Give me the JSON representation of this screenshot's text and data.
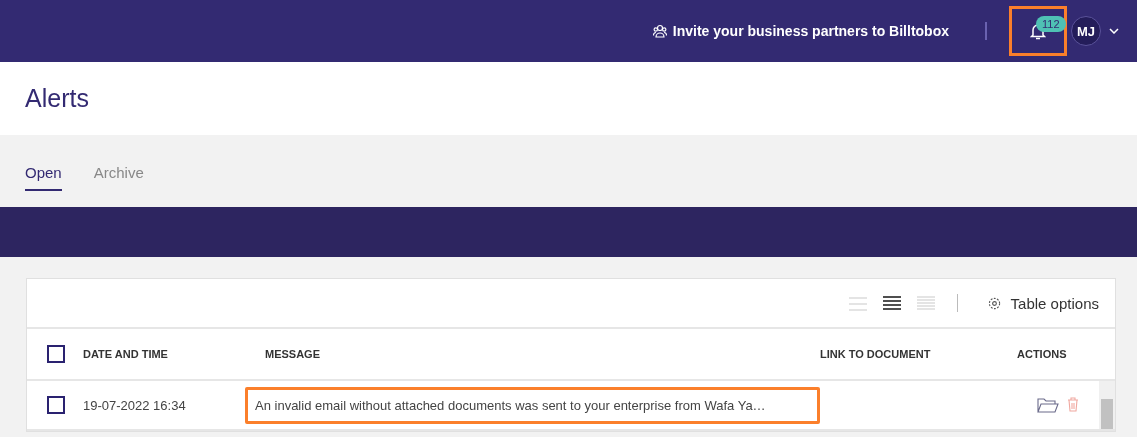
{
  "header": {
    "invite": "Invite your business partners to Billtobox",
    "notifications": {
      "count": "112",
      "highlighted": true
    },
    "user": {
      "initials": "MJ"
    }
  },
  "page": {
    "title": "Alerts"
  },
  "tabs": [
    {
      "label": "Open",
      "selected": true
    },
    {
      "label": "Archive",
      "selected": false
    }
  ],
  "toolbar": {
    "densities": [
      {
        "kind": "loose",
        "selected": false
      },
      {
        "kind": "medium",
        "selected": true
      },
      {
        "kind": "compact",
        "selected": false
      }
    ],
    "table_options": "Table options"
  },
  "table": {
    "select_all": {
      "checked": false
    },
    "columns": [
      "DATE AND TIME",
      "MESSAGE",
      "LINK TO DOCUMENT",
      "ACTIONS"
    ],
    "rows": [
      {
        "checked": false,
        "date": "19-07-2022 16:34",
        "message": "An invalid email without attached documents was sent to your enterprise from Wafa Ya…",
        "message_highlighted": true
      }
    ]
  }
}
